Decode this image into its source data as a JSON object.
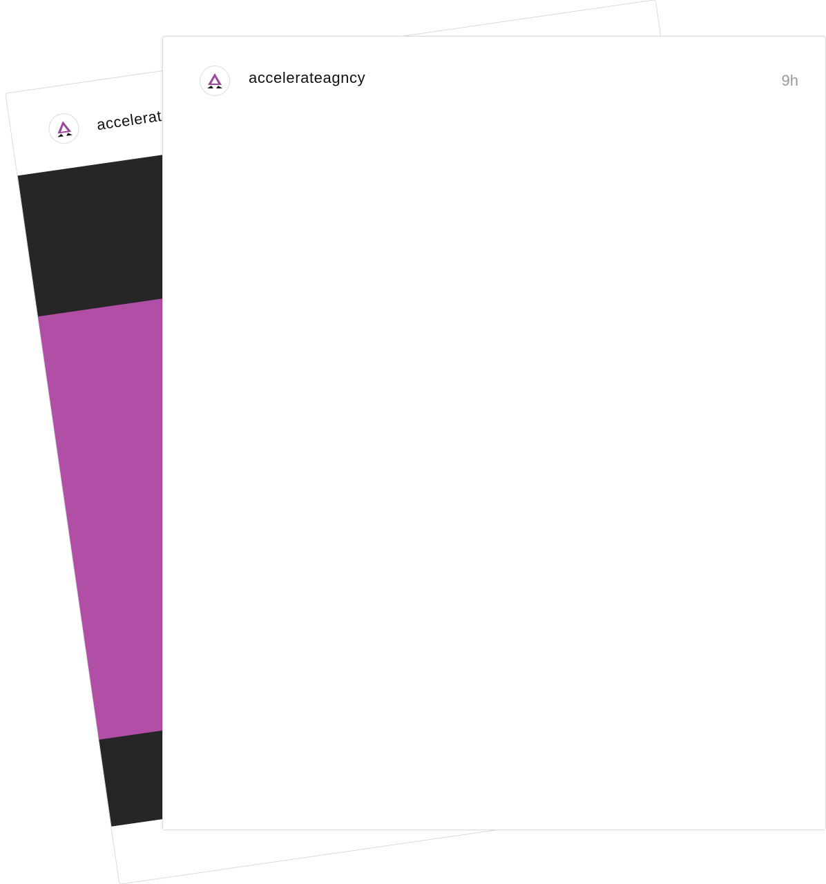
{
  "feed": {
    "back_post": {
      "username": "accelerateagncy",
      "avatar_icon": "accelerate-logo-icon",
      "media_colors": {
        "dark": "#262626",
        "accent": "#b14ea6"
      }
    },
    "front_post": {
      "username": "accelerateagncy",
      "timestamp": "9h",
      "avatar_icon": "accelerate-logo-icon"
    }
  },
  "colors": {
    "brand_purple": "#9b4a9b",
    "text_primary": "#111111",
    "text_muted": "#999999",
    "border": "#dbdbdb"
  }
}
